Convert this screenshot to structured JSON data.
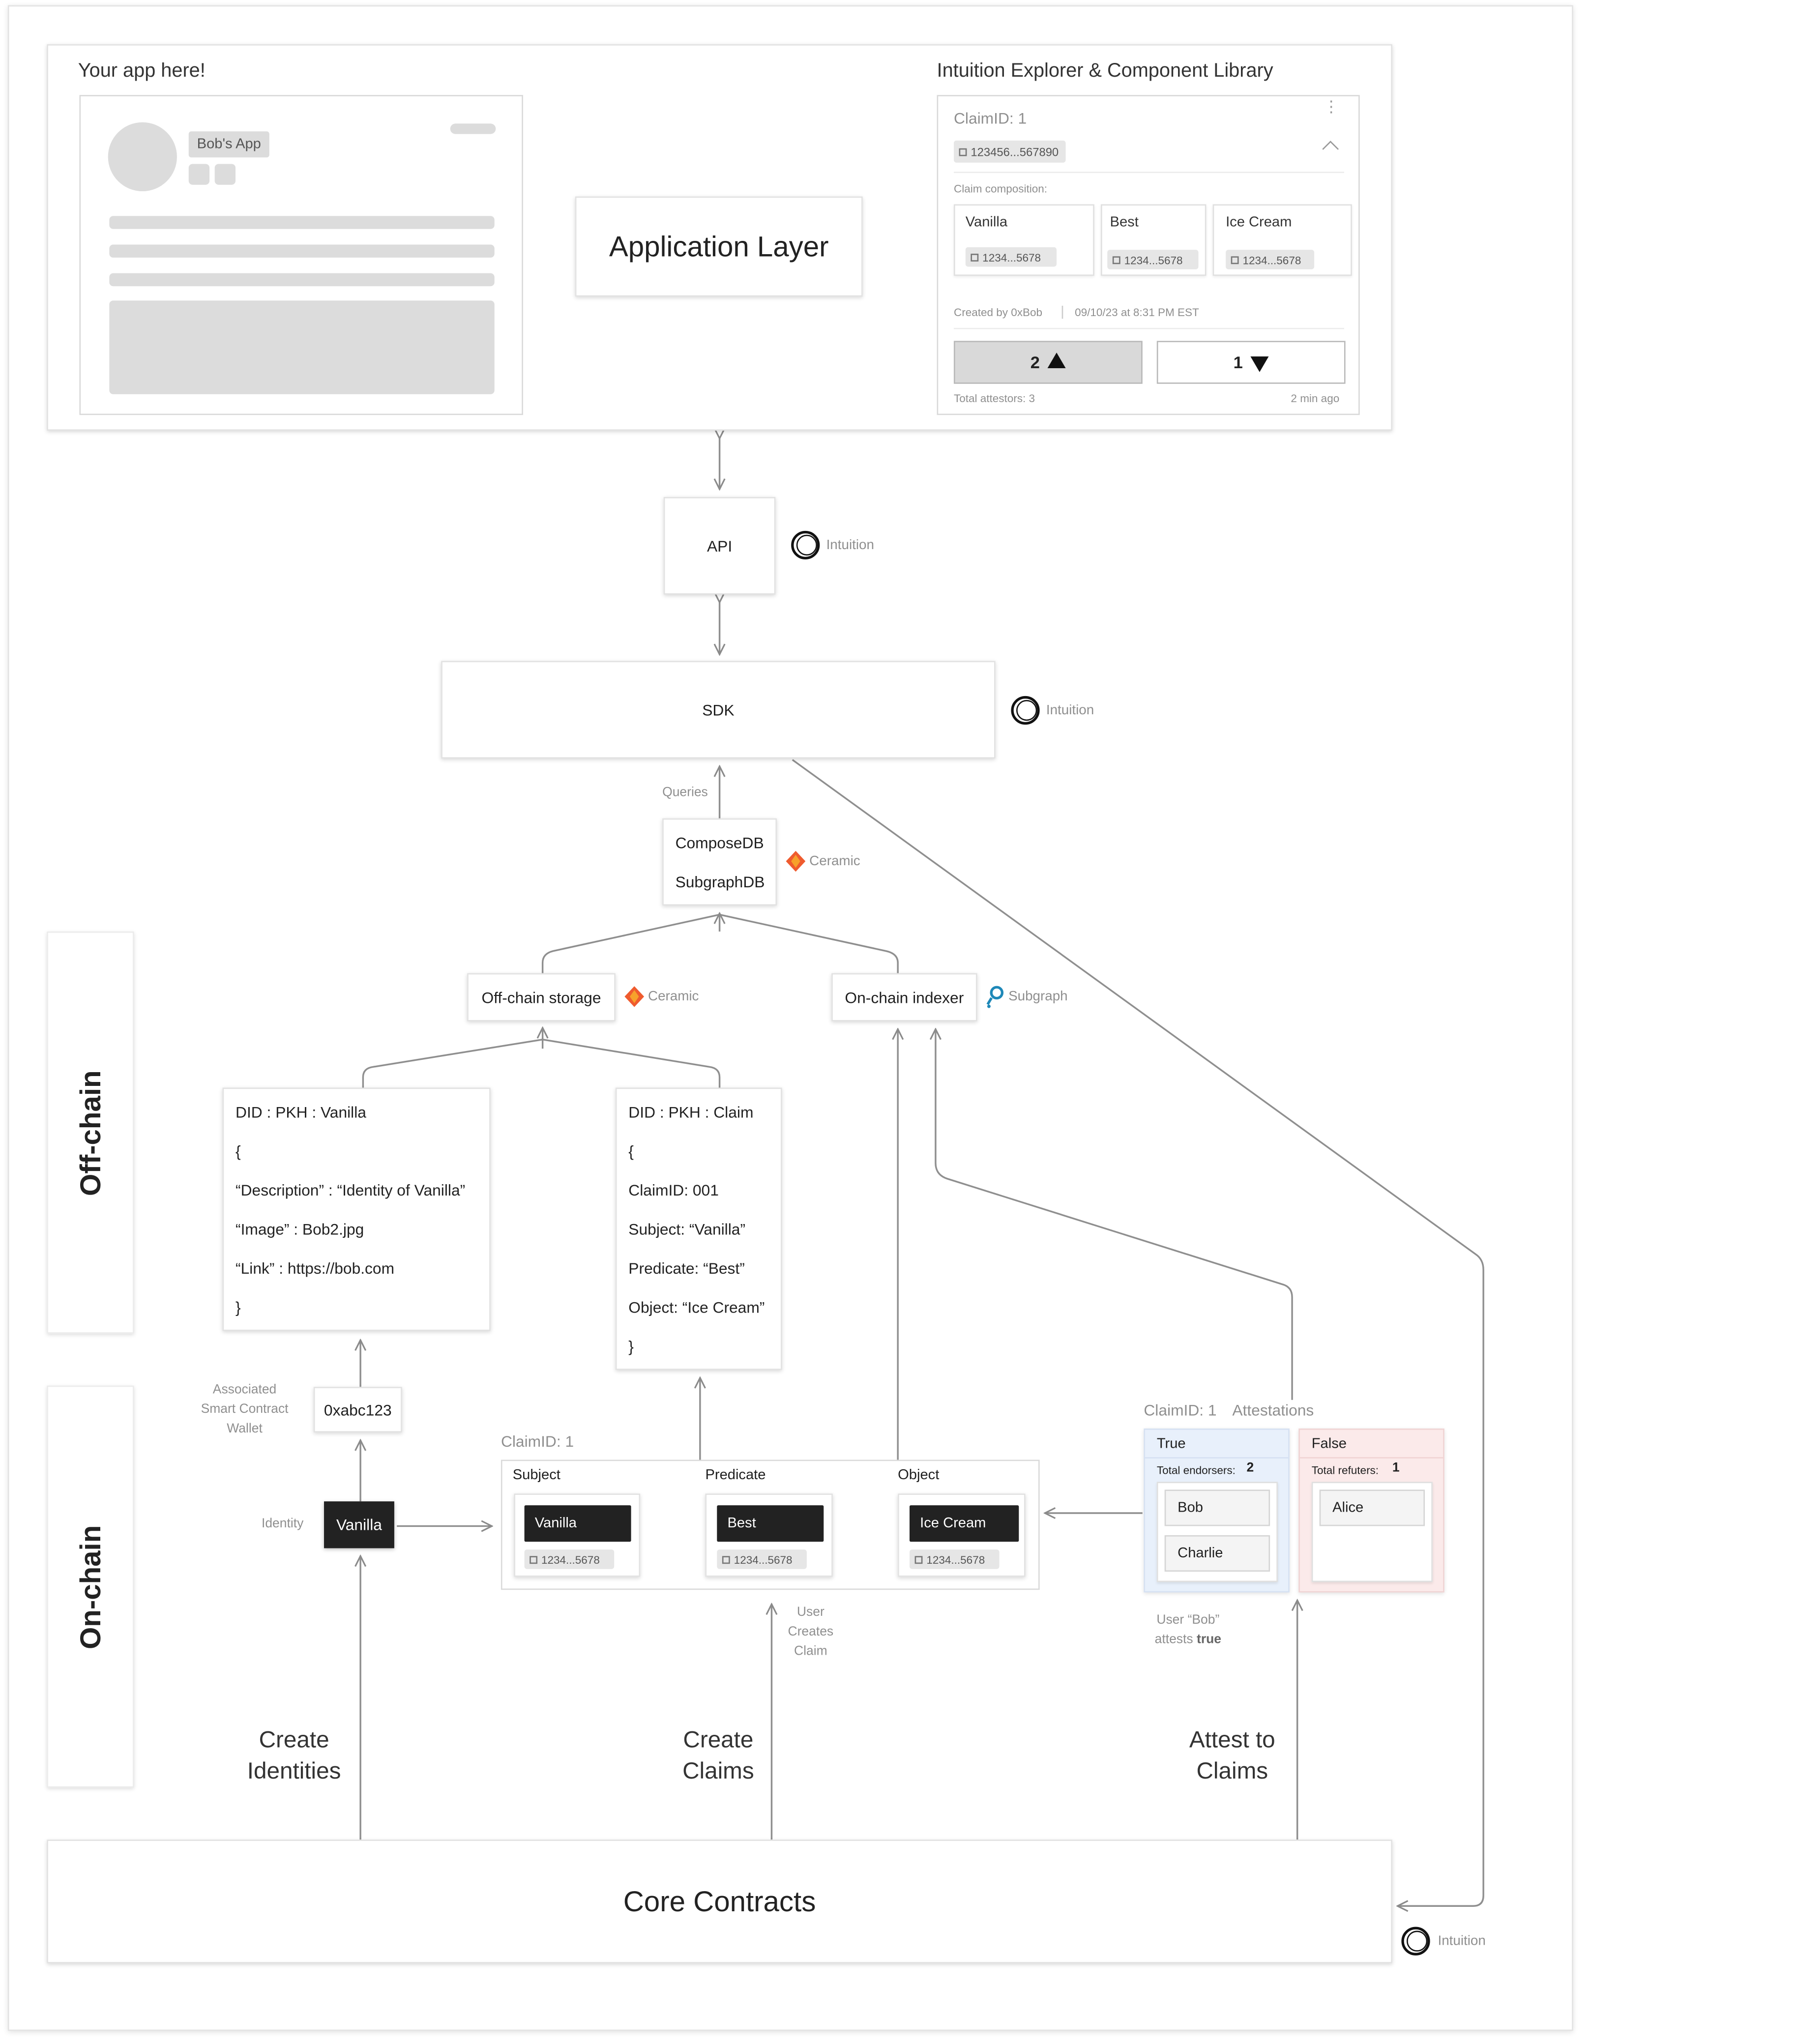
{
  "app_panel": {
    "title": "Your app here!",
    "app_name": "Bob's App"
  },
  "application_layer": {
    "label": "Application Layer"
  },
  "explorer": {
    "title": "Intuition Explorer & Component Library",
    "claim_id": "ClaimID: 1",
    "address": "123456...567890",
    "composition_label": "Claim composition:",
    "parts": [
      {
        "name": "Vanilla",
        "address": "1234...5678"
      },
      {
        "name": "Best",
        "address": "1234...5678"
      },
      {
        "name": "Ice Cream",
        "address": "1234...5678"
      }
    ],
    "created_by": "Created by 0xBob",
    "created_at": "09/10/23 at 8:31 PM EST",
    "upvotes": "2",
    "downvotes": "1",
    "total_attestors": "Total attestors: 3",
    "time_ago": "2 min ago"
  },
  "api": {
    "label": "API",
    "brand": "Intuition"
  },
  "sdk": {
    "label": "SDK",
    "brand": "Intuition"
  },
  "queries_label": "Queries",
  "compose": {
    "line1": "ComposeDB",
    "line2": "SubgraphDB",
    "brand": "Ceramic"
  },
  "offchain_storage": {
    "label": "Off-chain storage",
    "brand": "Ceramic"
  },
  "onchain_indexer": {
    "label": "On-chain indexer",
    "brand": "Subgraph"
  },
  "side_labels": {
    "offchain": "Off-chain",
    "onchain": "On-chain"
  },
  "identity_doc": {
    "lines": [
      "DID : PKH : Vanilla",
      "{",
      "“Description” : “Identity of Vanilla”",
      "“Image” : Bob2.jpg",
      "“Link” : https://bob.com",
      "}"
    ]
  },
  "claim_doc": {
    "lines": [
      "DID : PKH : Claim",
      "{",
      "ClaimID: 001",
      "Subject: “Vanilla”",
      "Predicate: “Best”",
      "Object: “Ice Cream”",
      "}"
    ]
  },
  "wallet": {
    "caption_lines": [
      "Associated",
      "Smart Contract",
      "Wallet"
    ],
    "address": "0xabc123"
  },
  "identity": {
    "caption": "Identity",
    "name": "Vanilla"
  },
  "claim": {
    "title": "ClaimID: 1",
    "columns": [
      {
        "heading": "Subject",
        "name": "Vanilla",
        "address": "1234...5678"
      },
      {
        "heading": "Predicate",
        "name": "Best",
        "address": "1234...5678"
      },
      {
        "heading": "Object",
        "name": "Ice Cream",
        "address": "1234...5678"
      }
    ]
  },
  "attestations": {
    "claim_id": "ClaimID: 1",
    "title": "Attestations",
    "true_label": "True",
    "endorsers_label": "Total endorsers:",
    "endorsers_count": "2",
    "endorsers": [
      "Bob",
      "Charlie"
    ],
    "false_label": "False",
    "refuters_label": "Total refuters:",
    "refuters_count": "1",
    "refuters": [
      "Alice"
    ],
    "true_color": "#e8f0fb",
    "false_color": "#fbeaea"
  },
  "user_creates_claim": [
    "User",
    "Creates",
    "Claim"
  ],
  "user_bob_attests": {
    "line1": "User “Bob”",
    "line2_prefix": "attests",
    "line2_bold": "true"
  },
  "actions": {
    "create_identities": [
      "Create",
      "Identities"
    ],
    "create_claims": [
      "Create",
      "Claims"
    ],
    "attest_claims": [
      "Attest to",
      "Claims"
    ]
  },
  "core": {
    "label": "Core Contracts",
    "brand": "Intuition"
  }
}
